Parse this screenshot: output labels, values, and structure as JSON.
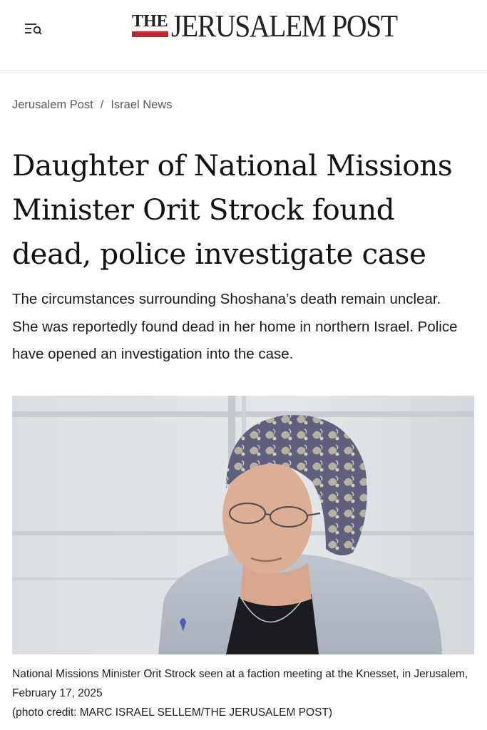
{
  "header": {
    "logo_the": "THE",
    "logo_name": "JERUSALEM POST",
    "brand_color": "#c0272d",
    "menu_icon": "menu-search-icon"
  },
  "breadcrumb": {
    "items": [
      "Jerusalem Post",
      "Israel News"
    ],
    "separator": "/"
  },
  "article": {
    "headline": "Daughter of National Missions Minister Orit Strock found dead, police investigate case",
    "summary": "The circumstances surrounding Shoshana’s death remain unclear.  She was reportedly found dead in her home in northern Israel. Police have opened an investigation into the case.",
    "image": {
      "caption": "National Missions Minister Orit Strock seen at a faction meeting at the Knesset, in Jerusalem, February 17, 2025",
      "credit": "(photo credit: MARC ISRAEL SELLEM/THE JERUSALEM POST)"
    }
  }
}
